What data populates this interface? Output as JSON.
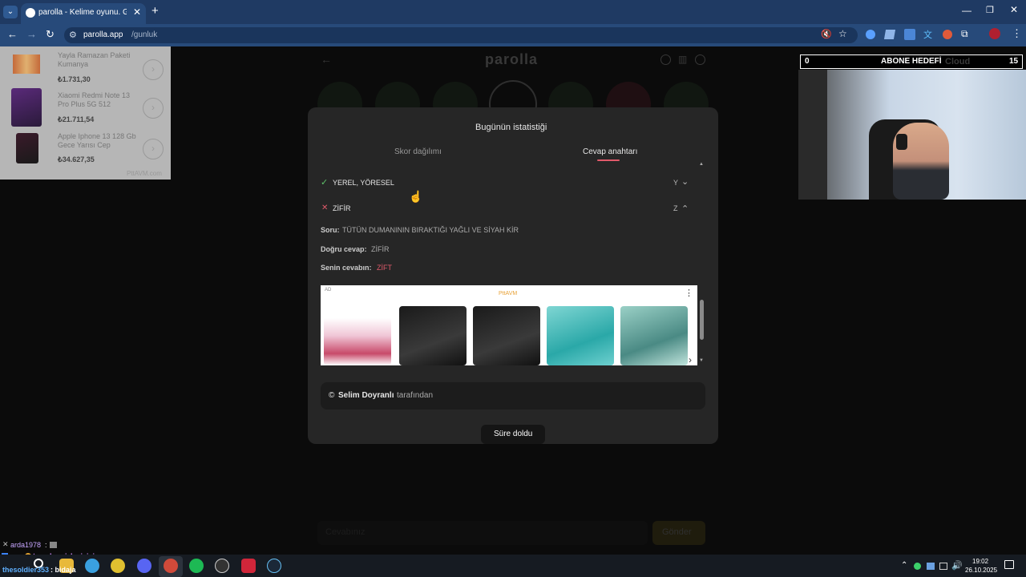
{
  "browser": {
    "tab_title": "parolla - Kelime oyunu. Günlük",
    "url_host": "parolla.app",
    "url_path": "/gunluk"
  },
  "game": {
    "logo": "parolla",
    "answer_input_placeholder": "Cevabınız",
    "submit_label": "Gönder"
  },
  "modal": {
    "title": "Bugünün istatistiği",
    "tabs": [
      "Skor dağılımı",
      "Cevap anahtarı"
    ],
    "active_tab": "Cevap anahtarı",
    "items": [
      {
        "status": "correct",
        "answer": "YEREL, YÖRESEL",
        "letter": "Y",
        "expanded": false
      },
      {
        "status": "wrong",
        "answer": "ZİFİR",
        "letter": "Z",
        "expanded": true
      }
    ],
    "detail": {
      "question_label": "Soru:",
      "question_text": "TÜTÜN DUMANININ BIRAKTIĞI YAĞLI VE SİYAH KİR",
      "correct_label": "Doğru cevap:",
      "correct_text": "ZİFİR",
      "your_label": "Senin cevabın:",
      "your_text": "ZİFT"
    },
    "ad": {
      "badge": "AD",
      "brand": "PttAVM"
    },
    "credit_icon": "©",
    "credit_name": "Selim Doyranlı",
    "credit_suffix": "tarafından",
    "timer_label": "Süre doldu"
  },
  "left_ad": {
    "products": [
      {
        "name": "Yayla Ramazan Paketi Kumanya",
        "price": "₺1.731,30"
      },
      {
        "name": "Xiaomi Redmi Note 13 Pro Plus 5G 512",
        "price": "₺21.711,54"
      },
      {
        "name": "Apple Iphone 13 128 Gb Gece Yarısı Cep",
        "price": "₺34.627,35"
      }
    ],
    "footer": "PttAVM.com"
  },
  "stream": {
    "goal_label": "ABONE HEDEFİ",
    "goal_current": "0",
    "goal_target": "15",
    "goal_watermark": "Cloud",
    "chat": [
      {
        "user": "arda1978",
        "msg": ":"
      },
      {
        "user": "tamekranizleyicisieray",
        "msg": ":"
      },
      {
        "user": "thesoldier353",
        "msg": ": bidaja"
      }
    ]
  },
  "taskbar": {
    "time": "19:02",
    "date": "26.10.2025"
  },
  "colors": {
    "accent_pink": "#e05a6a",
    "correct_green": "#5ec26a",
    "wrong_red": "#e05a6a",
    "chrome_blue": "#274a7a"
  }
}
